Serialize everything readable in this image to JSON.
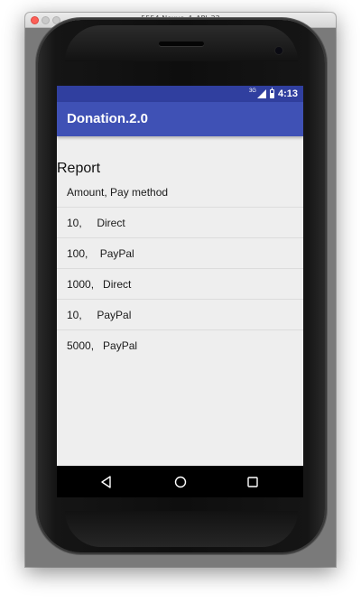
{
  "window": {
    "title": "5554:Nexus_4_API_22"
  },
  "status_bar": {
    "network_type": "3G",
    "time": "4:13",
    "color": "#303f9f"
  },
  "toolbar": {
    "title": "Donation.2.0",
    "color": "#3f51b5"
  },
  "report": {
    "heading": "Report",
    "rows": [
      "Amount, Pay method",
      "10,     Direct",
      "100,    PayPal",
      "1000,   Direct",
      "10,     PayPal",
      "5000,   PayPal"
    ]
  },
  "nav_bar": {
    "buttons": [
      "back-icon",
      "home-icon",
      "recents-icon"
    ]
  }
}
